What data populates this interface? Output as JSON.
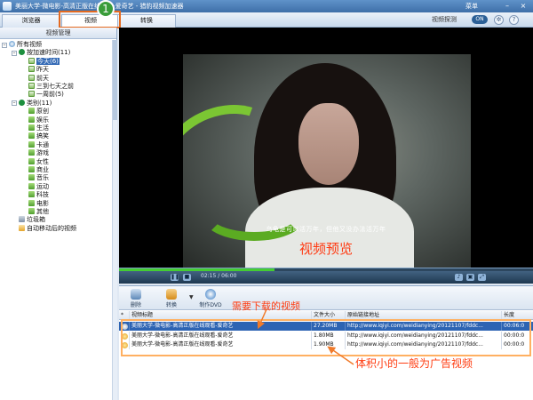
{
  "window": {
    "title": "美丽大学-微电影-高清正版在线观看-爱奇艺 - 猎豹视频加速器",
    "menu_label": "菜单",
    "min_glyph": "–",
    "close_glyph": "×"
  },
  "tabs": [
    {
      "label": "浏览器",
      "active": false
    },
    {
      "label": "视频",
      "active": true
    },
    {
      "label": "转换",
      "active": false
    }
  ],
  "header_right": {
    "toggle_label": "视频探测",
    "toggle_state": "ON",
    "settings_icon": "gear-icon",
    "help_glyph": "?"
  },
  "annotations": {
    "step_number": "1",
    "preview_label": "视频预览",
    "download_note": "需要下载的视频",
    "small_note": "体积小的一般为广告视频",
    "color": "#ff3c10"
  },
  "sidebar": {
    "header": "视频管理",
    "tree": [
      {
        "label": "所有视频",
        "icon": "globe-icon"
      },
      {
        "label": "按加速时间(11)",
        "icon": "clock-icon"
      },
      {
        "label": "今天(6)",
        "icon": "calendar-icon",
        "selected": true
      },
      {
        "label": "昨天",
        "icon": "calendar-icon"
      },
      {
        "label": "前天",
        "icon": "calendar-icon"
      },
      {
        "label": "三到七天之前",
        "icon": "calendar-icon"
      },
      {
        "label": "一周前(5)",
        "icon": "calendar-icon"
      },
      {
        "label": "类别(11)",
        "icon": "category-icon"
      },
      {
        "label": "原创",
        "icon": "folder-icon"
      },
      {
        "label": "娱乐",
        "icon": "folder-icon"
      },
      {
        "label": "生活",
        "icon": "folder-icon"
      },
      {
        "label": "搞笑",
        "icon": "folder-icon"
      },
      {
        "label": "卡通",
        "icon": "folder-icon"
      },
      {
        "label": "游戏",
        "icon": "folder-icon"
      },
      {
        "label": "女性",
        "icon": "folder-icon"
      },
      {
        "label": "商业",
        "icon": "folder-icon"
      },
      {
        "label": "音乐",
        "icon": "folder-icon"
      },
      {
        "label": "运动",
        "icon": "folder-icon"
      },
      {
        "label": "科技",
        "icon": "folder-icon"
      },
      {
        "label": "电影",
        "icon": "folder-icon"
      },
      {
        "label": "其他",
        "icon": "folder-icon"
      },
      {
        "label": "垃圾箱",
        "icon": "trash-icon"
      },
      {
        "label": "自动移动后的视频",
        "icon": "auto-move-icon"
      }
    ]
  },
  "player": {
    "subtitle": "乌龟是可以活万年，但他又没办法活万年",
    "time": "02:15 / 06:00",
    "progress_fraction": 0.375
  },
  "toolbar": {
    "delete_label": "删除",
    "convert_label": "转换",
    "dvd_label": "制作DVD"
  },
  "table": {
    "columns": [
      "*",
      "视频标题",
      "文件大小",
      "原始链接地址",
      "长度"
    ],
    "rows": [
      {
        "title": "美丽大学-微电影-高清正版在线观看-爱奇艺",
        "size": "27.20MB",
        "url": "http://www.iqiyi.com/weidianying/20121107/fddc...",
        "duration": "00:06:0",
        "selected": true,
        "status_icon": "ok-icon"
      },
      {
        "title": "美丽大学-微电影-高清正版在线观看-爱奇艺",
        "size": "1.80MB",
        "url": "http://www.iqiyi.com/weidianying/20121107/fddc...",
        "duration": "00:00:0",
        "selected": false,
        "status_icon": "warning-icon"
      },
      {
        "title": "美丽大学-微电影-高清正版在线观看-爱奇艺",
        "size": "1.90MB",
        "url": "http://www.iqiyi.com/weidianying/20121107/fddc...",
        "duration": "00:00:0",
        "selected": false,
        "status_icon": "warning-icon"
      }
    ]
  }
}
